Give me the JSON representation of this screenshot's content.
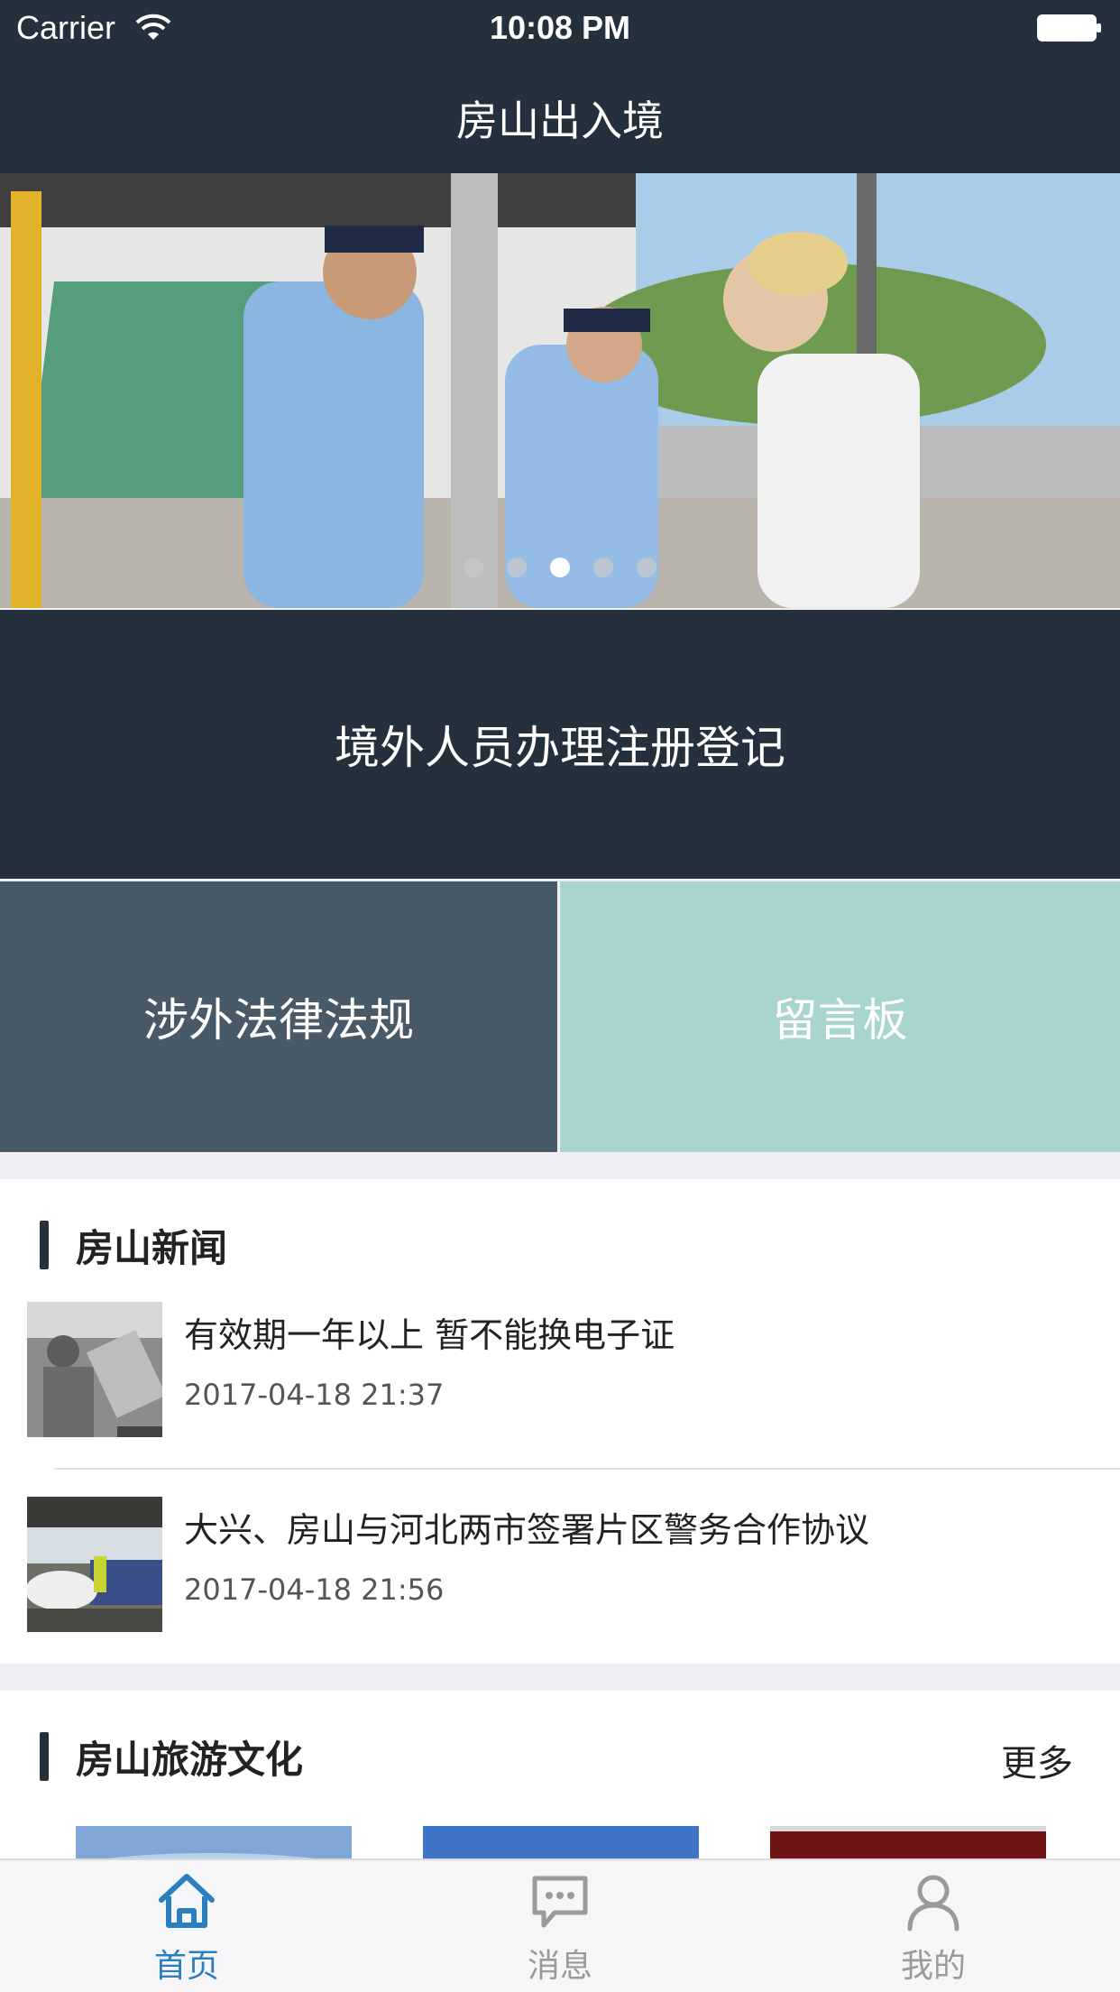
{
  "status_bar": {
    "carrier": "Carrier",
    "time": "10:08 PM"
  },
  "nav": {
    "title": "房山出入境"
  },
  "banner": {
    "slide_count": 5,
    "active_slide": 3
  },
  "tiles": {
    "register": "境外人员办理注册登记",
    "law": "涉外法律法规",
    "board": "留言板"
  },
  "news": {
    "title": "房山新闻",
    "items": [
      {
        "title": "有效期一年以上 暂不能换电子证",
        "date": "2017-04-18 21:37"
      },
      {
        "title": "大兴、房山与河北两市签署片区警务合作协议",
        "date": "2017-04-18 21:56"
      }
    ]
  },
  "tourism": {
    "title": "房山旅游文化",
    "more": "更多"
  },
  "tabbar": {
    "items": [
      {
        "label": "首页",
        "icon": "home-icon",
        "active": true
      },
      {
        "label": "消息",
        "icon": "message-icon",
        "active": false
      },
      {
        "label": "我的",
        "icon": "profile-icon",
        "active": false
      }
    ]
  },
  "colors": {
    "primary_dark": "#24313c",
    "slate": "#485a68",
    "mint": "#a8d5cf",
    "active_tab": "#2a7fc1"
  }
}
